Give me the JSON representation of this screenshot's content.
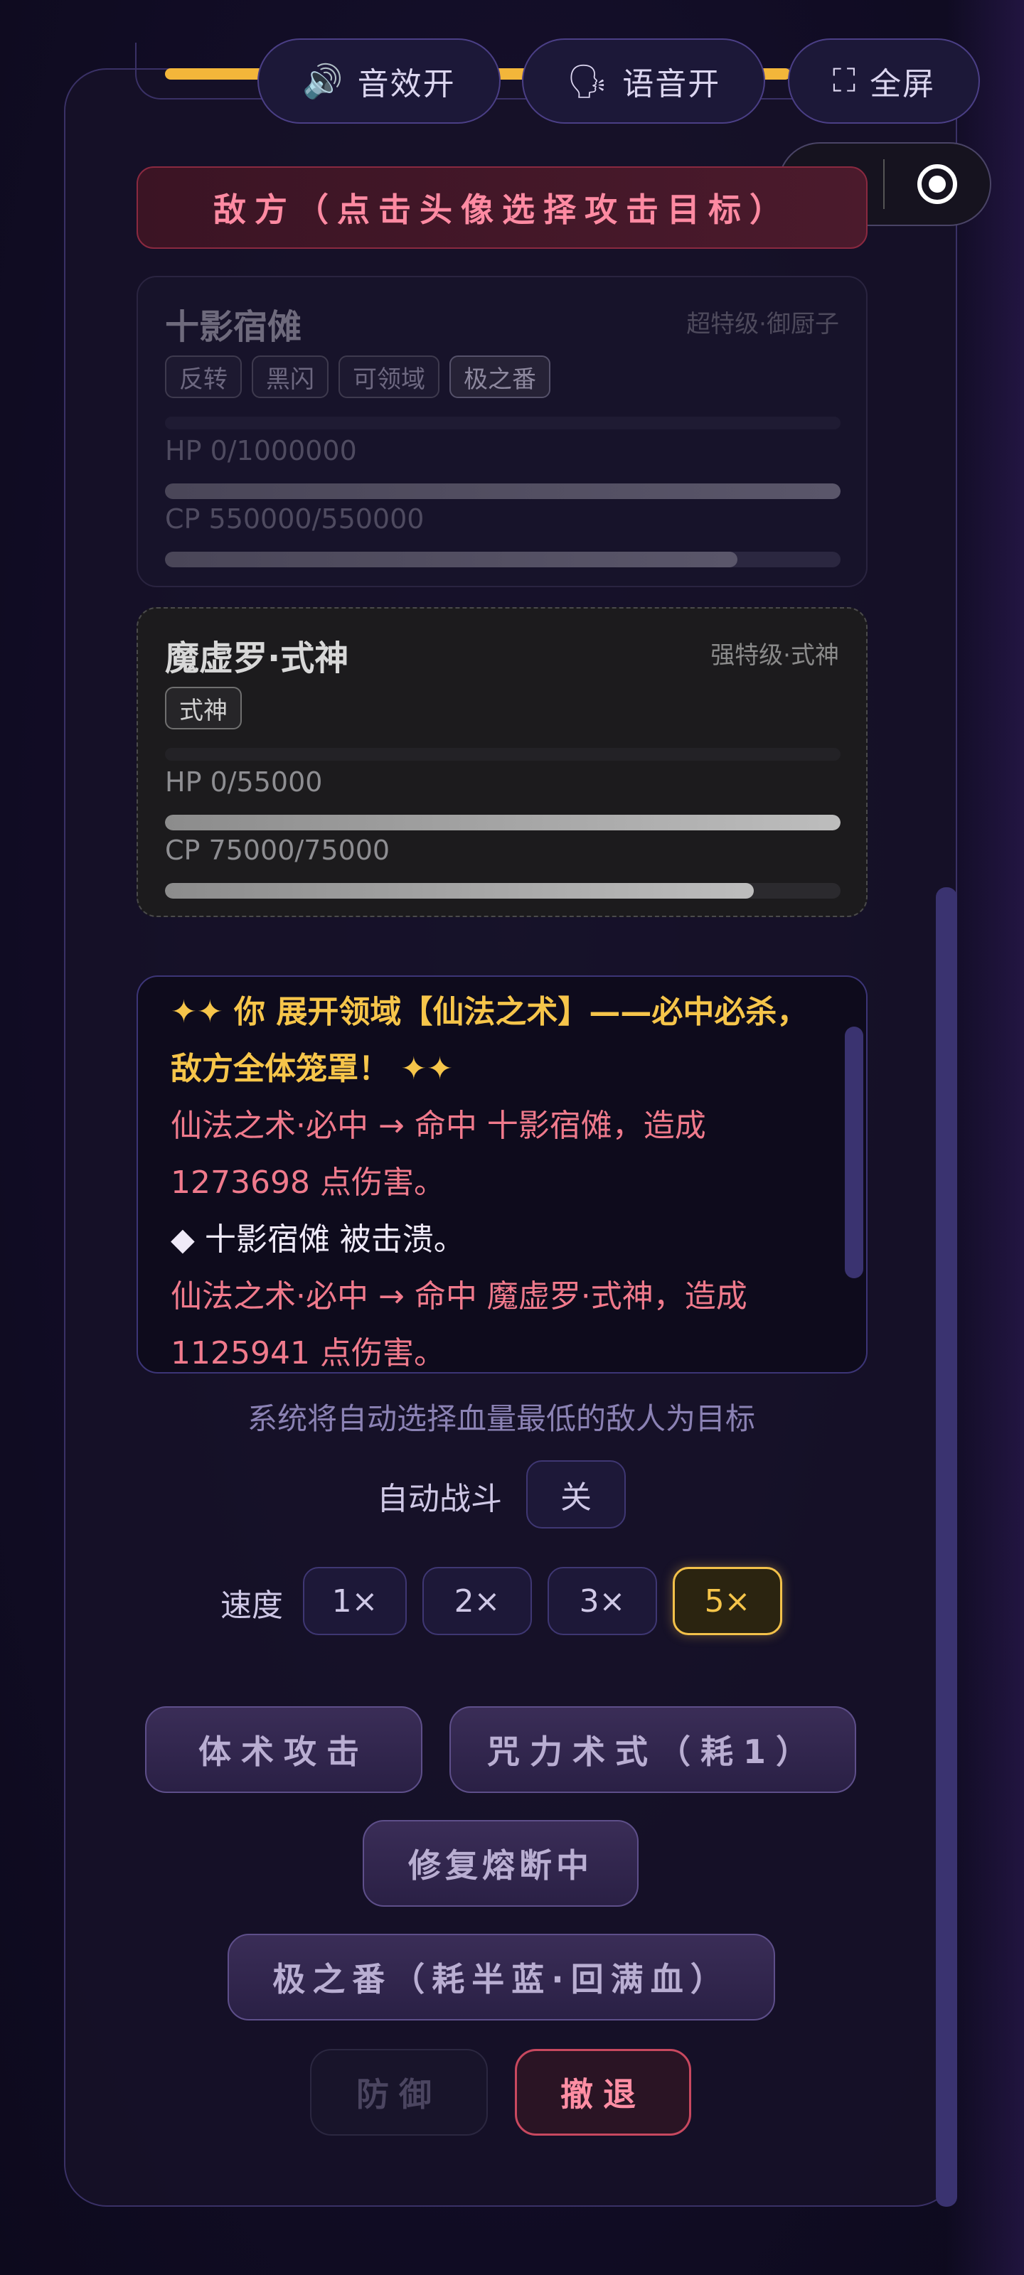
{
  "toolbar": {
    "sound": {
      "icon": "speaker-icon",
      "label": "音效开"
    },
    "voice": {
      "icon": "speaking-head-icon",
      "label": "语音开"
    },
    "fullscreen": {
      "icon": "fullscreen-icon",
      "label": "全屏"
    }
  },
  "enemy_header": "敌方（点击头像选择攻击目标）",
  "enemies": [
    {
      "name": "十影宿傩",
      "class": "超特级·御厨子",
      "tags": [
        "反转",
        "黑闪",
        "可领域",
        "极之番"
      ],
      "hp_text": "HP 0/1000000",
      "cp_text": "CP 550000/550000",
      "hp_fraction": 1.0,
      "cp_fraction": 0.847,
      "defeated": true
    },
    {
      "name": "魔虚罗·式神",
      "class": "强特级·式神",
      "tags": [
        "式神"
      ],
      "hp_text": "HP 0/55000",
      "cp_text": "CP 75000/75000",
      "hp_fraction": 1.0,
      "cp_fraction": 0.872,
      "defeated": true
    }
  ],
  "log": {
    "lines": [
      {
        "style": "gold",
        "text": "✦✦ 你 展开领域【仙法之术】——必中必杀，敌方全体笼罩！ ✦✦"
      },
      {
        "style": "red",
        "text": "仙法之术·必中 → 命中 十影宿傩，造成 1273698 点伤害。"
      },
      {
        "style": "white",
        "text": "◆ 十影宿傩 被击溃。"
      },
      {
        "style": "red",
        "text": "仙法之术·必中 → 命中 魔虚罗·式神，造成 1125941 点伤害。"
      }
    ]
  },
  "hint": "系统将自动选择血量最低的敌人为目标",
  "auto_battle": {
    "label": "自动战斗",
    "value": "关"
  },
  "speed": {
    "label": "速度",
    "options": [
      "1×",
      "2×",
      "3×",
      "5×"
    ],
    "selected": "5×"
  },
  "actions": {
    "melee": "体术攻击",
    "curse": "咒力术式（耗1）",
    "repair": "修复熔断中",
    "ultimate": "极之番（耗半蓝·回满血）",
    "defend": "防御",
    "retreat": "撤退"
  },
  "colors": {
    "accent_gold": "#f3c14a",
    "enemy_red": "#ff8aa2",
    "log_red": "#f07a8c",
    "panel_border": "#3a3166"
  }
}
